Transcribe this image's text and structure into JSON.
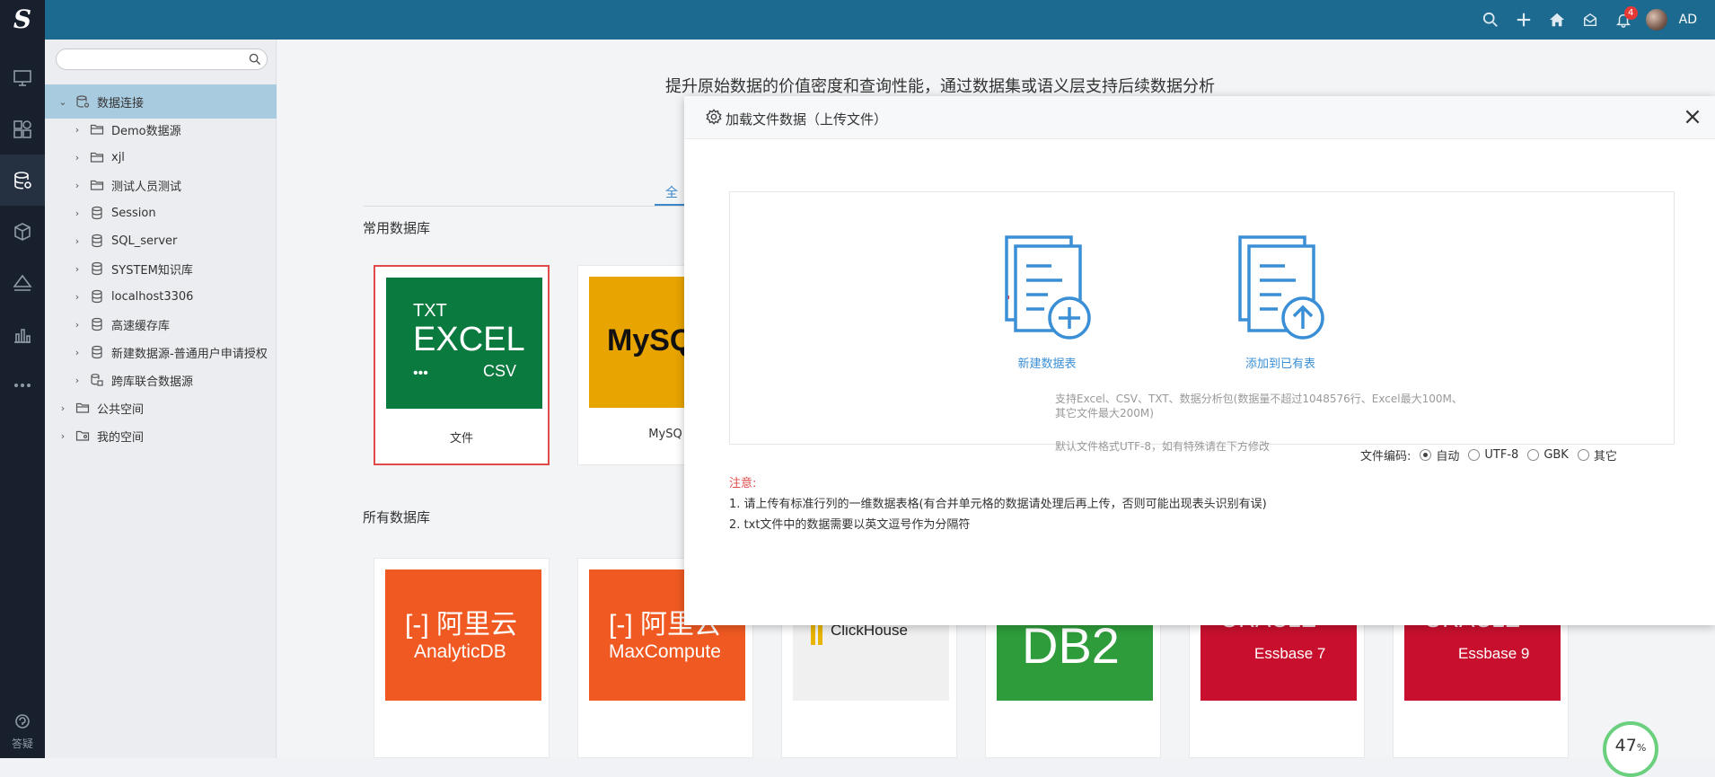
{
  "header": {
    "logo": "S",
    "notification_count": "4",
    "user_name": "AD",
    "icons": [
      "search-icon",
      "plus-icon",
      "home-icon",
      "mailbox-icon",
      "bell-icon"
    ]
  },
  "leftnav": {
    "items": [
      "monitor-icon",
      "dashboard-icon",
      "database-settings-icon",
      "cube-icon",
      "layers-icon",
      "bar-chart-icon",
      "more-icon"
    ],
    "help_label": "答疑"
  },
  "tree": {
    "search_placeholder": "",
    "items": [
      {
        "label": "数据连接",
        "icon": "database-settings-icon",
        "level": 0,
        "expanded": true
      },
      {
        "label": "Demo数据源",
        "icon": "folder-icon",
        "level": 1
      },
      {
        "label": "xjl",
        "icon": "folder-icon",
        "level": 1
      },
      {
        "label": "测试人员测试",
        "icon": "folder-icon",
        "level": 1
      },
      {
        "label": "Session",
        "icon": "database-icon",
        "level": 1
      },
      {
        "label": "SQL_server",
        "icon": "database-icon",
        "level": 1
      },
      {
        "label": "SYSTEM知识库",
        "icon": "database-icon",
        "level": 1
      },
      {
        "label": "localhost3306",
        "icon": "database-icon",
        "level": 1
      },
      {
        "label": "高速缓存库",
        "icon": "database-icon",
        "level": 1
      },
      {
        "label": "新建数据源-普通用户申请授权",
        "icon": "database-icon",
        "level": 1
      },
      {
        "label": "跨库联合数据源",
        "icon": "database-link-icon",
        "level": 1
      },
      {
        "label": "公共空间",
        "icon": "folder-icon",
        "level": 0
      },
      {
        "label": "我的空间",
        "icon": "user-folder-icon",
        "level": 0
      }
    ]
  },
  "main": {
    "title": "提升原始数据的价值密度和查询性能，通过数据集或语义层支持后续数据分析",
    "tab_active": "全",
    "section_common": "常用数据库",
    "section_all": "所有数据库",
    "common_cards": [
      {
        "caption": "文件",
        "lines": [
          "TXT",
          "EXCEL",
          "•••",
          "CSV"
        ],
        "color": "#0a7a3f"
      },
      {
        "caption": "MySQ",
        "lines": [
          "MySQ"
        ],
        "color": "#e8a400"
      }
    ],
    "all_cards": [
      {
        "brand": "阿里云",
        "name": "AnalyticDB",
        "color": "#f05a22"
      },
      {
        "brand": "阿里云",
        "name": "MaxCompute",
        "color": "#f05a22"
      },
      {
        "name": "ClickHouse",
        "color": "#f0f0f0"
      },
      {
        "name": "DB2",
        "color": "#2e9c3a"
      },
      {
        "brand": "ORACLE",
        "name": "Essbase 7",
        "color": "#c8102e"
      },
      {
        "brand": "ORACLE",
        "name": "Essbase 9",
        "color": "#c8102e"
      }
    ],
    "progress": {
      "value": "47",
      "unit": "%"
    }
  },
  "modal": {
    "title": "加载文件数据（上传文件）",
    "new_table_label": "新建数据表",
    "add_existing_label": "添加到已有表",
    "desc_line1": "支持Excel、CSV、TXT、数据分析包(数据量不超过1048576行、Excel最大100M、",
    "desc_line2": "其它文件最大200M)",
    "hint": "默认文件格式UTF-8，如有特殊请在下方修改",
    "encoding_label": "文件编码:",
    "encoding_options": [
      "自动",
      "UTF-8",
      "GBK",
      "其它"
    ],
    "encoding_selected": "自动",
    "note_title": "注意:",
    "note_1": "1. 请上传有标准行列的一维数据表格(有合并单元格的数据请处理后再上传，否则可能出现表头识别有误)",
    "note_2": "2. txt文件中的数据需要以英文逗号作为分隔符"
  }
}
